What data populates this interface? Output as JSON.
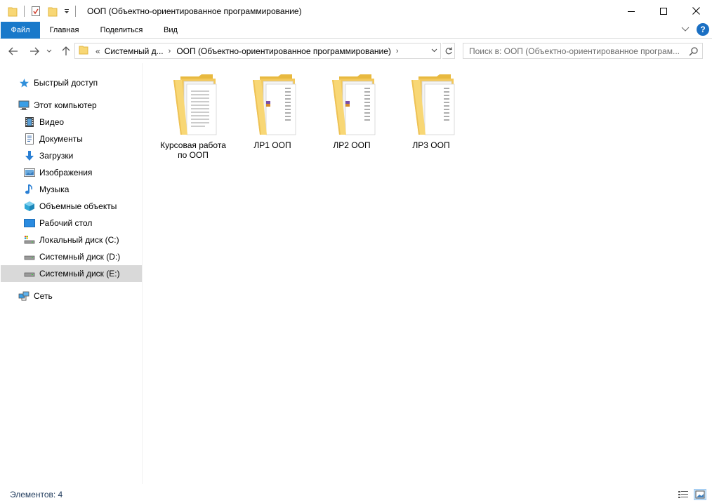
{
  "window": {
    "title": "ООП (Объектно-ориентированное программирование)"
  },
  "ribbon": {
    "tabs": [
      "Файл",
      "Главная",
      "Поделиться",
      "Вид"
    ]
  },
  "address": {
    "overflow": "«",
    "crumbs": [
      "Системный д...",
      "ООП (Объектно-ориентированное программирование)"
    ]
  },
  "search": {
    "placeholder": "Поиск в: ООП (Объектно-ориентированное програм..."
  },
  "navigation": {
    "items": [
      {
        "label": "Быстрый доступ",
        "icon": "star-icon"
      },
      {
        "label": "Этот компьютер",
        "icon": "computer-icon"
      },
      {
        "label": "Видео",
        "icon": "video-icon"
      },
      {
        "label": "Документы",
        "icon": "documents-icon"
      },
      {
        "label": "Загрузки",
        "icon": "downloads-icon"
      },
      {
        "label": "Изображения",
        "icon": "pictures-icon"
      },
      {
        "label": "Музыка",
        "icon": "music-icon"
      },
      {
        "label": "Объемные объекты",
        "icon": "3d-objects-icon"
      },
      {
        "label": "Рабочий стол",
        "icon": "desktop-icon"
      },
      {
        "label": "Локальный диск (C:)",
        "icon": "drive-c-icon"
      },
      {
        "label": "Системный диск (D:)",
        "icon": "drive-icon"
      },
      {
        "label": "Системный диск (E:)",
        "icon": "drive-icon",
        "selected": true
      },
      {
        "label": "Сеть",
        "icon": "network-icon"
      }
    ]
  },
  "content": {
    "items": [
      {
        "line1": "Курсовая работа",
        "line2": "по ООП",
        "icon": "folder-icon"
      },
      {
        "line1": "ЛР1 ООП",
        "line2": "",
        "icon": "folder-icon"
      },
      {
        "line1": "ЛР2 ООП",
        "line2": "",
        "icon": "folder-icon"
      },
      {
        "line1": "ЛР3 ООП",
        "line2": "",
        "icon": "folder-icon"
      }
    ]
  },
  "status": {
    "items_count": "Элементов: 4"
  },
  "colors": {
    "file_tab": "#1979ca",
    "folder": "#f8d775",
    "selected": "#d9d9d9"
  }
}
